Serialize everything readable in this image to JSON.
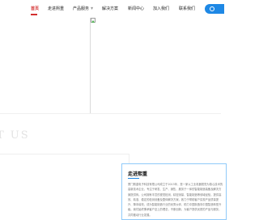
{
  "nav": {
    "items": [
      {
        "label": "首页",
        "active": true
      },
      {
        "label": "走进熙重",
        "active": false
      },
      {
        "label": "产品服务",
        "active": false,
        "has_dropdown": true
      },
      {
        "label": "解决方案",
        "active": false
      },
      {
        "label": "新闻中心",
        "active": false
      },
      {
        "label": "加入我们",
        "active": false
      },
      {
        "label": "联系我们",
        "active": false
      }
    ],
    "accent_color": "#d32f2f",
    "contact_button_color": "#1e88e5"
  },
  "hero": {
    "image_state": "broken-image-icon"
  },
  "watermark": {
    "text": "T US"
  },
  "about": {
    "title": "走进熙重",
    "body": "厦门熙重电子科技有限公司成立于2015年，是一家以工业机器视觉为核心技术的高新技术企业，专注于研发、生产、销售、服务于一体的智能制造装备及解决方案提供商。公司拥有丰富的视觉检测、精密测量、智能制造等领域经验，提供高效、精准、稳定的检测设备及整体解决方案，致力于帮助客户实现产品质量提升、降本增效，成为智能制造行业的优秀伙伴，助力中国制造向中国智造转型升级。我们始终秉承客户至上的理念，不断创新，为客户提供优质的产品与服务，共同推动行业发展。"
  }
}
